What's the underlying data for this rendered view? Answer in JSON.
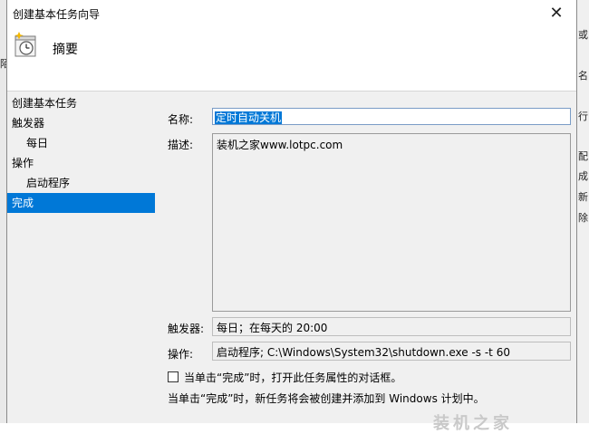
{
  "window": {
    "title": "创建基本任务向导",
    "close_glyph": "✕"
  },
  "header": {
    "title": "摘要",
    "icon": "task-clock-icon"
  },
  "nav": {
    "items": [
      {
        "label": "创建基本任务",
        "level": "top"
      },
      {
        "label": "触发器",
        "level": "top"
      },
      {
        "label": "每日",
        "level": "sub"
      },
      {
        "label": "操作",
        "level": "top"
      },
      {
        "label": "启动程序",
        "level": "sub"
      },
      {
        "label": "完成",
        "level": "top",
        "active": true
      }
    ]
  },
  "form": {
    "name_label": "名称:",
    "name_value": "定时自动关机",
    "description_label": "描述:",
    "description_value": "装机之家www.lotpc.com",
    "trigger_label": "触发器:",
    "trigger_value": "每日；在每天的 20:00",
    "action_label": "操作:",
    "action_value": "启动程序; C:\\Windows\\System32\\shutdown.exe -s -t 60"
  },
  "options": {
    "open_properties_label": "当单击“完成”时，打开此任务属性的对话框。",
    "open_properties_checked": false,
    "note": "当单击“完成”时，新任务将会被创建并添加到 Windows 计划中。"
  },
  "background": {
    "left_char": "陌",
    "right_chars": [
      "或",
      "名",
      "行",
      "配",
      "成",
      "新",
      "除"
    ],
    "watermark": "装机之家"
  },
  "colors": {
    "accent": "#0078d7",
    "panel": "#f0f0f0"
  }
}
